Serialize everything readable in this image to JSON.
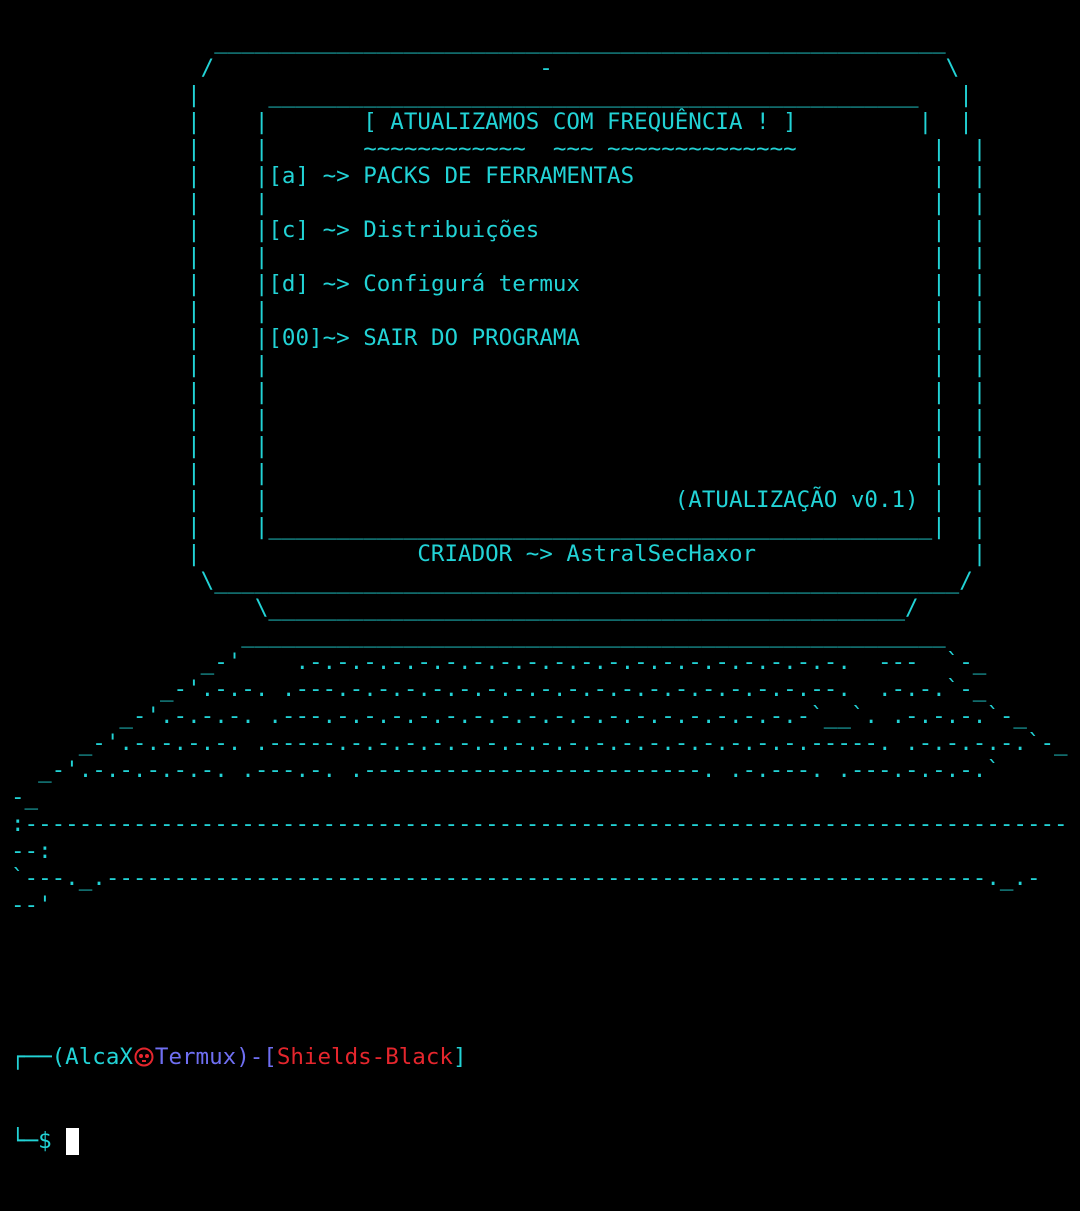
{
  "colors": {
    "background": "#000000",
    "art": "#22d3d6",
    "prompt_user": "#22d3d6",
    "prompt_host": "#6f6ff2",
    "prompt_dir": "#e5262d",
    "cursor": "#ffffff"
  },
  "menu": {
    "title": "[ ATUALIZAMOS COM FREQUÊNCIA ! ]",
    "items": [
      {
        "key": "[a]",
        "label": "~> PACKS DE FERRAMENTAS"
      },
      {
        "key": "[c]",
        "label": "~> Distribuições"
      },
      {
        "key": "[d]",
        "label": "~> Configurá termux"
      },
      {
        "key": "[00]",
        "label": "~> SAIR DO PROGRAMA"
      }
    ],
    "version": "(ATUALIZAÇÃO v0.1)",
    "creator": "CRIADOR ~> AstralSecHaxor"
  },
  "art_lines": [
    "               ______________________________________________________",
    "              /                        -                             \\",
    "             |     ________________________________________________   |",
    "             |    |       [ ATUALIZAMOS COM FREQUÊNCIA ! ]         |  |",
    "             |    |       ~~~~~~~~~~~~  ~~~ ~~~~~~~~~~~~~~          |  |",
    "             |    |[a] ~> PACKS DE FERRAMENTAS                      |  |",
    "             |    |                                                 |  |",
    "             |    |[c] ~> Distribuições                             |  |",
    "             |    |                                                 |  |",
    "             |    |[d] ~> Configurá termux                          |  |",
    "             |    |                                                 |  |",
    "             |    |[00]~> SAIR DO PROGRAMA                          |  |",
    "             |    |                                                 |  |",
    "             |    |                                                 |  |",
    "             |    |                                                 |  |",
    "             |    |                                                 |  |",
    "             |    |                                                 |  |",
    "             |    |                              (ATUALIZAÇÃO v0.1) |  |",
    "             |    |_________________________________________________|  |",
    "             |                CRIADOR ~> AstralSecHaxor                |",
    "              \\_______________________________________________________/",
    "                  \\_______________________________________________/",
    "                 ____________________________________________________",
    "              _-'    .-.-.-.-.-.-.-.-.-.-.-.-.-.-.-.-.-.-.-.-.  ---  `-_",
    "           _-'.-.-. .---.-.-.-.-.-.-.-.-.-.-.-.-.-.-.-.-.-.--.  .-.-.`-_",
    "        _-'.-.-.-. .---.-.-.-.-.-.-.-.-.-.-.-.-.-.-.-.-.-.-`__`. .-.-.-.`-_",
    "     _-'.-.-.-.-. .-----.-.-.-.-.-.-.-.-.-.-.-.-.-.-.-.-.-.-----. .-.-.-.-.`-_",
    "  _-'.-.-.-.-.-. .---.-. .-------------------------. .-.---. .---.-.-.-.`",
    "-_",
    ":-----------------------------------------------------------------------------",
    "--:",
    "`---._.-----------------------------------------------------------------._.-",
    "--'"
  ],
  "prompt": {
    "line1_corner": "┌──",
    "user": "(AlcaX",
    "host": "Termux)",
    "sep_left": "-[",
    "dir": "Shields-Black",
    "sep_right": "]",
    "line2_corner": "└─",
    "symbol": "$",
    "skull_icon": "skull-icon"
  }
}
